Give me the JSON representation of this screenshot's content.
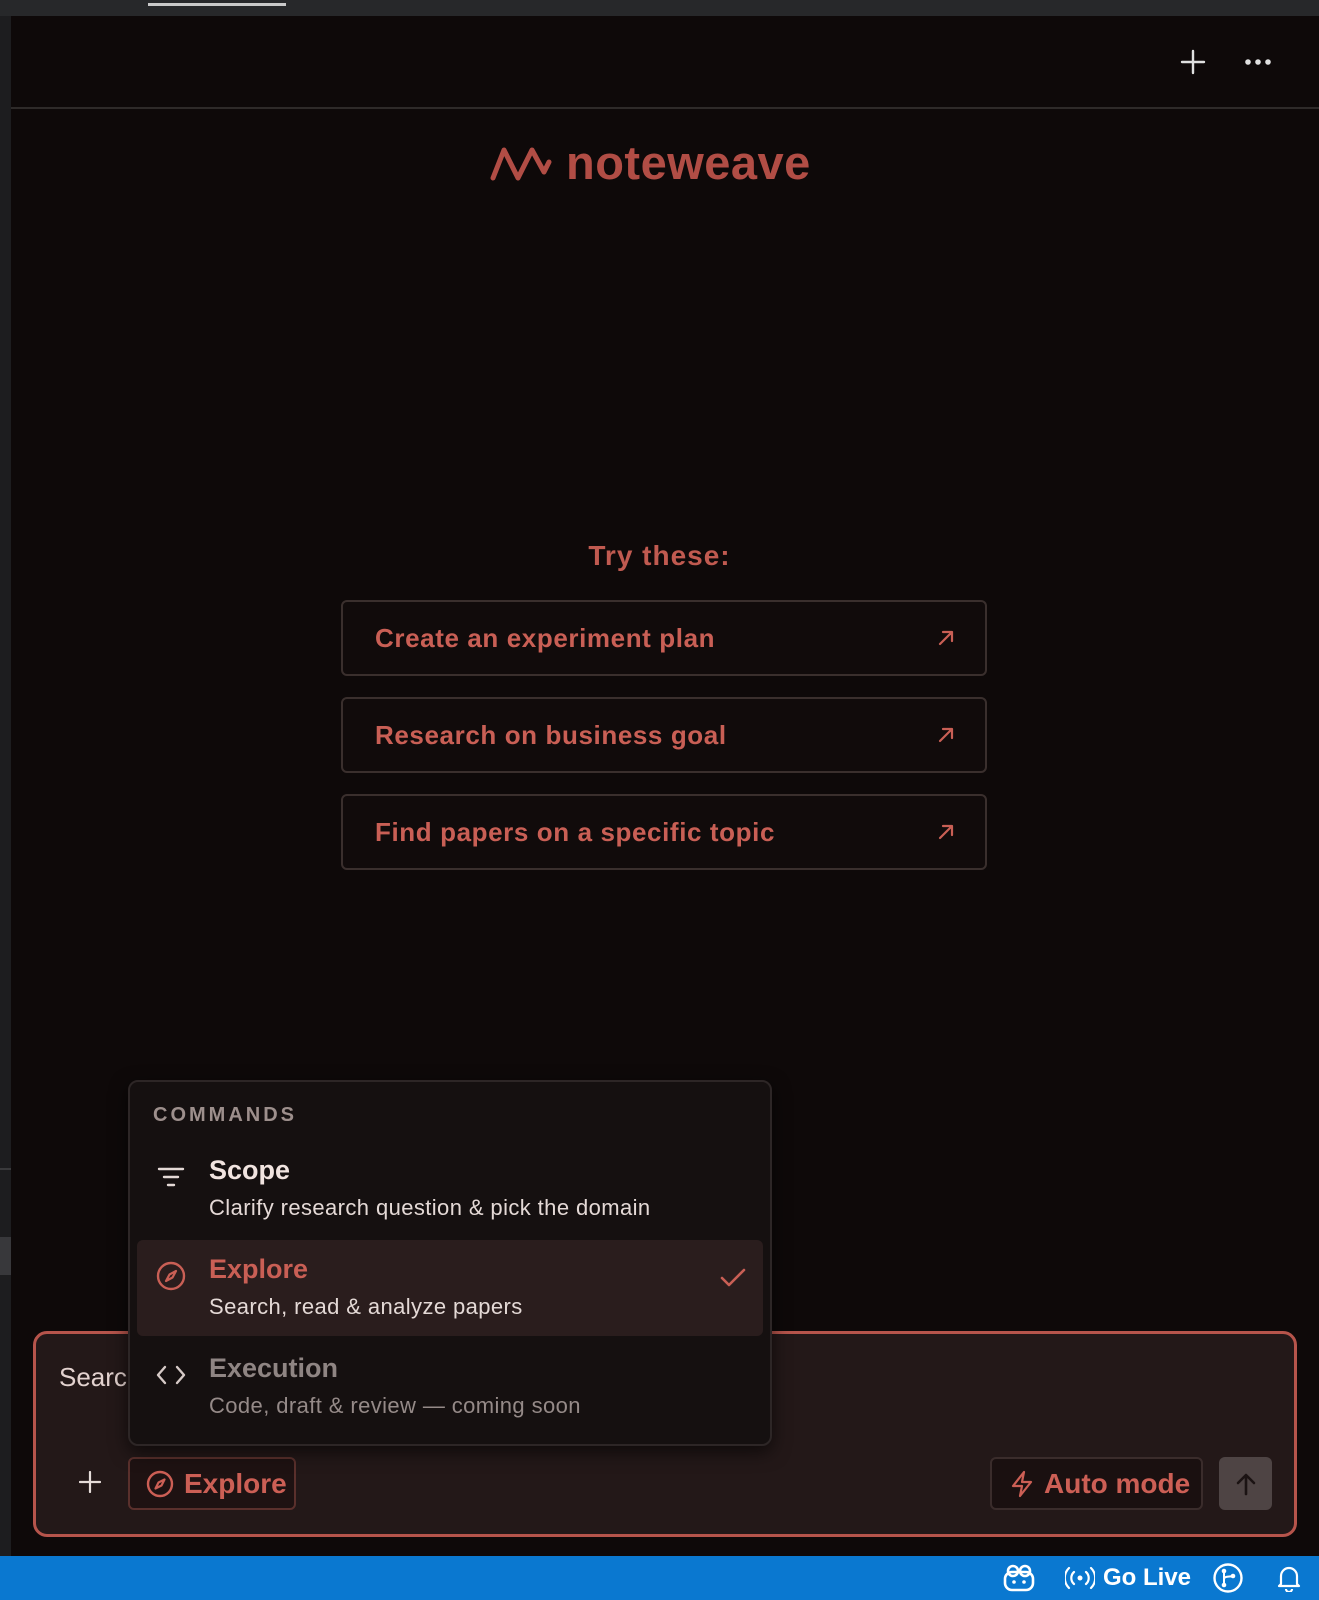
{
  "app": {
    "brand_name": "noteweave",
    "accent_color": "#c95f55",
    "background_color": "#0e0909"
  },
  "header": {
    "new_icon": "plus-icon",
    "more_icon": "ellipsis-icon"
  },
  "suggestions": {
    "title": "Try these:",
    "items": [
      {
        "label": "Create an experiment plan",
        "icon": "arrow-up-right-icon"
      },
      {
        "label": "Research on business goal",
        "icon": "arrow-up-right-icon"
      },
      {
        "label": "Find papers on a specific topic",
        "icon": "arrow-up-right-icon"
      }
    ]
  },
  "commands": {
    "title": "COMMANDS",
    "items": [
      {
        "name": "Scope",
        "description": "Clarify research question & pick the domain",
        "icon": "filter-lines-icon",
        "selected": false
      },
      {
        "name": "Explore",
        "description": "Search, read & analyze papers",
        "icon": "compass-icon",
        "selected": true
      },
      {
        "name": "Execution",
        "description": "Code, draft & review — coming soon",
        "icon": "code-brackets-icon",
        "selected": false
      }
    ]
  },
  "composer": {
    "input_value": "Searc",
    "mode_button_label": "Explore",
    "auto_mode_label": "Auto mode",
    "send_icon": "arrow-up-icon",
    "attach_icon": "plus-icon"
  },
  "status_bar": {
    "color": "#0a78d0",
    "go_live_label": "Go Live",
    "items": [
      "copilot-icon",
      "broadcast-icon",
      "git-graph-icon",
      "bell-icon"
    ]
  }
}
